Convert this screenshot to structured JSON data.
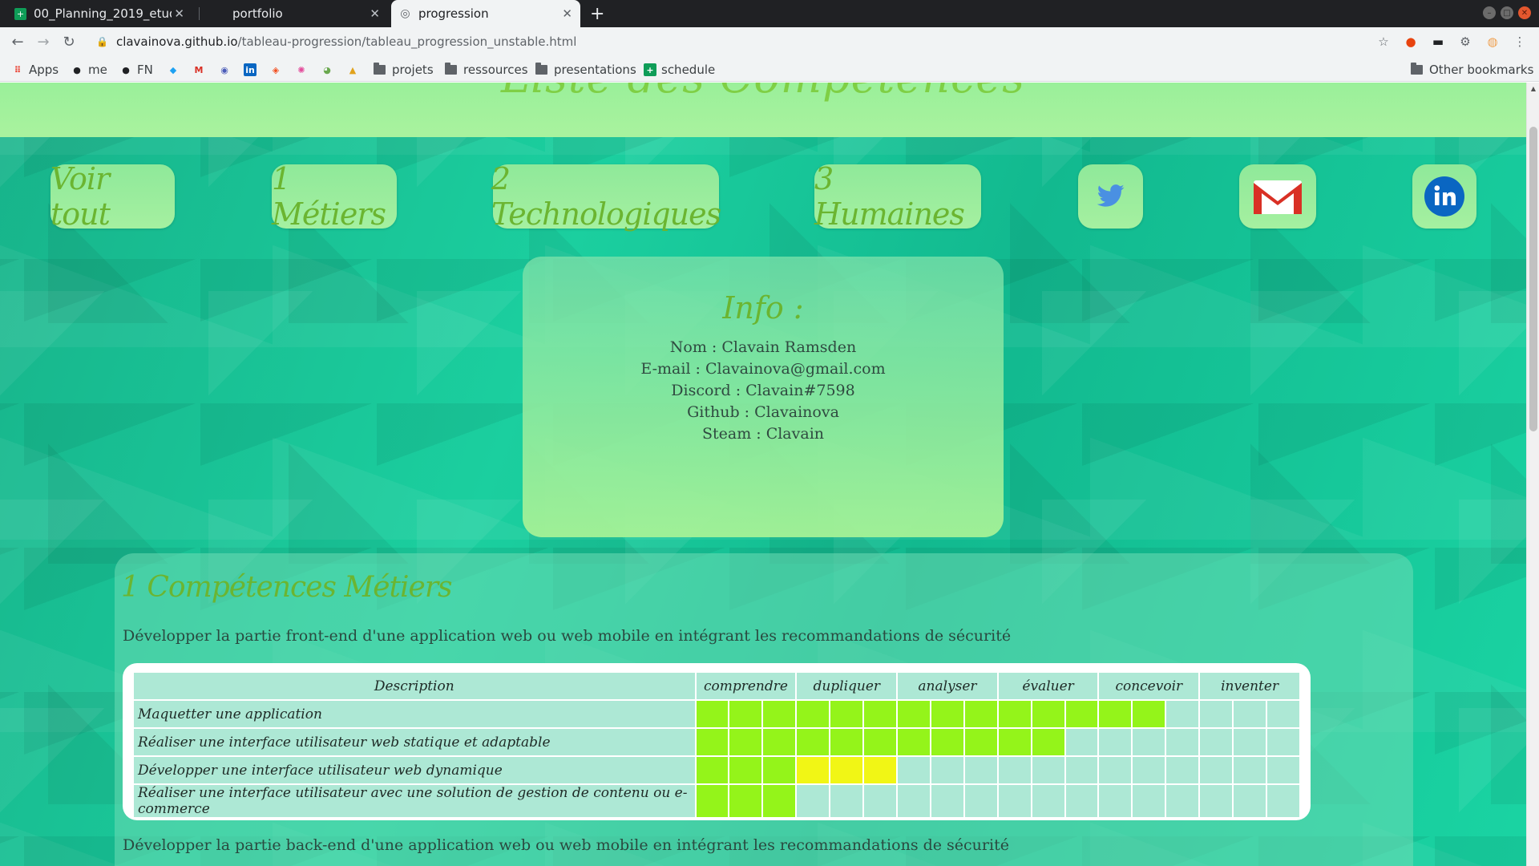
{
  "browser": {
    "tabs": [
      {
        "title": "00_Planning_2019_etudia",
        "active": false
      },
      {
        "title": "portfolio",
        "active": false
      },
      {
        "title": "progression",
        "active": true
      }
    ],
    "url_host": "clavainova.github.io",
    "url_path": "/tableau-progression/tableau_progression_unstable.html",
    "bookmarks": [
      "Apps",
      "me",
      "FN",
      "projets",
      "ressources",
      "presentations",
      "schedule"
    ],
    "other_bookmarks": "Other bookmarks"
  },
  "page": {
    "header_title": "Liste des Compétences",
    "nav": [
      "Voir tout",
      "1 Métiers",
      "2 Technologiques",
      "3 Humaines"
    ],
    "info": {
      "title": "Info :",
      "lines": [
        "Nom : Clavain Ramsden",
        "E-mail : Clavainova@gmail.com",
        "Discord : Clavain#7598",
        "Github : Clavainova",
        "Steam : Clavain"
      ]
    },
    "section": {
      "title": "1 Compétences Métiers",
      "subtitle1": "Développer la partie front-end d'une application web ou web mobile en intégrant les recommandations de sécurité",
      "subtitle2": "Développer la partie back-end d'une application web ou web mobile en intégrant les recommandations de sécurité",
      "table": {
        "header_desc": "Description",
        "levels": [
          "comprendre",
          "dupliquer",
          "analyser",
          "évaluer",
          "concevoir",
          "inventer"
        ],
        "rows": [
          {
            "label": "Maquetter une application",
            "green": 14,
            "yellow": 0
          },
          {
            "label": "Réaliser une interface utilisateur web statique et adaptable",
            "green": 11,
            "yellow": 0
          },
          {
            "label": "Développer une interface utilisateur web dynamique",
            "green": 3,
            "yellow": 3
          },
          {
            "label": "Réaliser une interface utilisateur avec une solution de gestion de contenu ou e-commerce",
            "green": 3,
            "yellow": 0
          }
        ]
      }
    }
  },
  "colors": {
    "filled": "#94f41a",
    "partial": "#f1f615",
    "empty": "#ade8d5",
    "title_green": "#6bb531"
  }
}
